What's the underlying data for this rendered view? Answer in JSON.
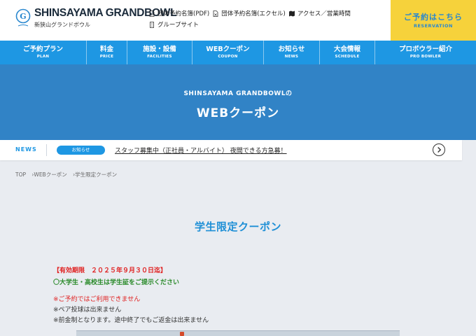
{
  "header": {
    "logo_title": "SHINSAYAMA GRANDBOWL",
    "logo_sub": "新狭山グランドボウル",
    "links_row1": [
      {
        "label": "団体予約名簿(PDF)",
        "icon": "pdf-file-icon"
      },
      {
        "label": "団体予約名簿(エクセル)",
        "icon": "excel-file-icon"
      },
      {
        "label": "アクセス／営業時間",
        "icon": "map-icon"
      }
    ],
    "links_row2": [
      {
        "label": "グループサイト",
        "icon": "building-icon"
      }
    ],
    "reserve": {
      "label": "ご予約はこちら",
      "sub": "RESERVATION",
      "color": "#f6d23b"
    }
  },
  "nav": [
    {
      "jp": "ご予約プラン",
      "en": "PLAN"
    },
    {
      "jp": "料金",
      "en": "PRICE"
    },
    {
      "jp": "施設・設備",
      "en": "FACILITIES"
    },
    {
      "jp": "WEBクーポン",
      "en": "COUPON"
    },
    {
      "jp": "お知らせ",
      "en": "NEWS"
    },
    {
      "jp": "大会情報",
      "en": "SCHEDULE"
    },
    {
      "jp": "プロボウラー紹介",
      "en": "PRO BOWLER"
    }
  ],
  "hero": {
    "subtitle": "SHINSAYAMA GRANDBOWLの",
    "title": "WEBクーポン",
    "color": "#3183c6"
  },
  "news": {
    "label": "NEWS",
    "badge": "お知らせ",
    "text": "スタッフ募集中（正社員・アルバイト） 夜間できる方急募！"
  },
  "breadcrumb": [
    "TOP",
    "›WEBクーポン",
    "›学生限定クーポン"
  ],
  "content": {
    "title": "学生限定クーポン",
    "validity": "【有効期限　２０２５年９月３０日迄】",
    "condition": "〇大学生・高校生は学生証をご提示ください",
    "notes": [
      "※ご予約ではご利用できません",
      "※ペア投球は出来ません",
      "※前金制となります。途中終了でもご返金は出来ません"
    ]
  }
}
